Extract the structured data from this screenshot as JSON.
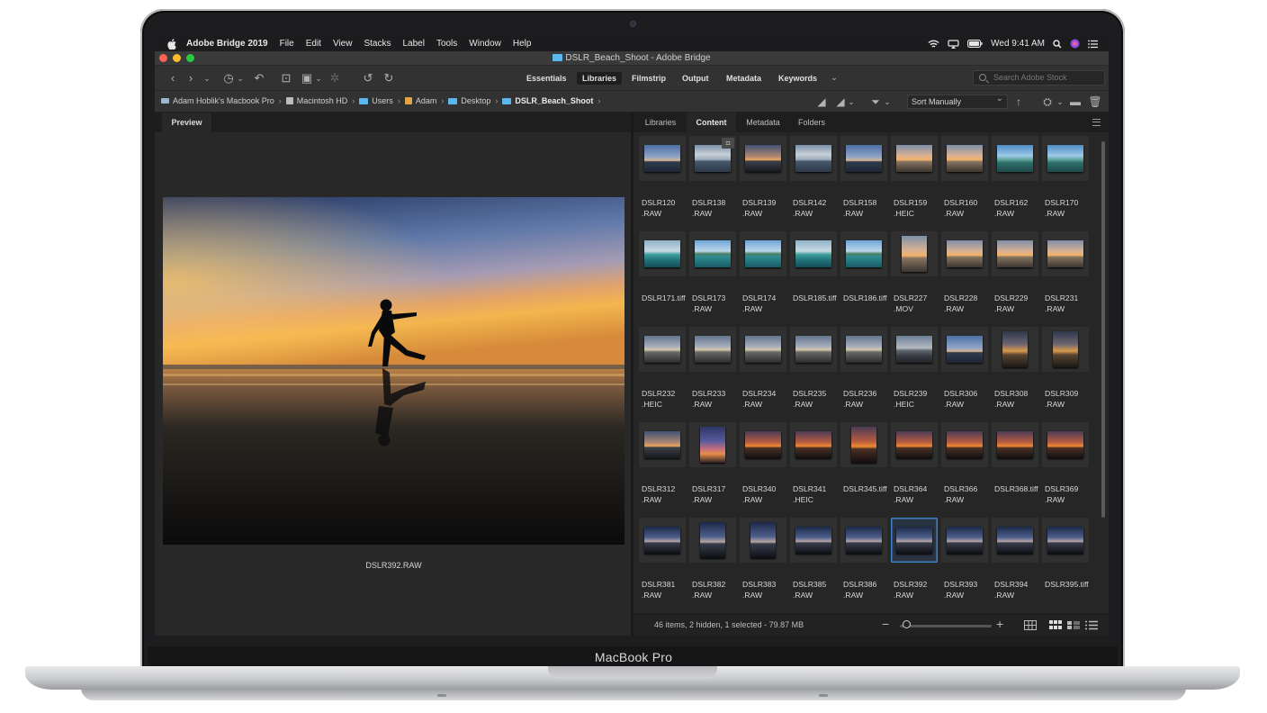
{
  "device": {
    "label": "MacBook Pro"
  },
  "menubar": {
    "app_name": "Adobe Bridge 2019",
    "items": [
      "File",
      "Edit",
      "View",
      "Stacks",
      "Label",
      "Tools",
      "Window",
      "Help"
    ],
    "clock": "Wed 9:41 AM"
  },
  "window": {
    "title": "DSLR_Beach_Shoot - Adobe Bridge",
    "traffic_light_colors": [
      "#ff5f57",
      "#febc2e",
      "#28c840"
    ]
  },
  "toolbar": {
    "workspaces": [
      "Essentials",
      "Libraries",
      "Filmstrip",
      "Output",
      "Metadata",
      "Keywords"
    ],
    "active_workspace": "Libraries",
    "search_placeholder": "Search Adobe Stock"
  },
  "path": {
    "crumbs": [
      {
        "label": "Adam Hoblik's Macbook Pro",
        "icon": "laptop-icon"
      },
      {
        "label": "Macintosh HD",
        "icon": "drive-icon"
      },
      {
        "label": "Users",
        "icon": "folder-icon"
      },
      {
        "label": "Adam",
        "icon": "home-icon"
      },
      {
        "label": "Desktop",
        "icon": "folder-icon"
      },
      {
        "label": "DSLR_Beach_Shoot",
        "icon": "folder-icon"
      }
    ],
    "sort": "Sort Manually"
  },
  "preview": {
    "tab": "Preview",
    "caption": "DSLR392.RAW"
  },
  "content": {
    "tabs": [
      "Libraries",
      "Content",
      "Metadata",
      "Folders"
    ],
    "active_tab": "Content",
    "items": [
      {
        "name": "DSLR120\n.RAW",
        "palette": "blue-dusk"
      },
      {
        "name": "DSLR138\n.RAW",
        "palette": "cloudy-sea",
        "badge": "crop-icon"
      },
      {
        "name": "DSLR139\n.RAW",
        "palette": "sunset-sea"
      },
      {
        "name": "DSLR142\n.RAW",
        "palette": "cloudy-sea"
      },
      {
        "name": "DSLR158\n.RAW",
        "palette": "blue-dusk"
      },
      {
        "name": "DSLR159\n.HEIC",
        "palette": "warm-sky"
      },
      {
        "name": "DSLR160\n.RAW",
        "palette": "warm-sky"
      },
      {
        "name": "DSLR162\n.RAW",
        "palette": "tropical"
      },
      {
        "name": "DSLR170\n.RAW",
        "palette": "tropical"
      },
      {
        "name": "DSLR171.tiff",
        "palette": "teal-boat"
      },
      {
        "name": "DSLR173\n.RAW",
        "palette": "island"
      },
      {
        "name": "DSLR174\n.RAW",
        "palette": "island"
      },
      {
        "name": "DSLR185.tiff",
        "palette": "teal-boat"
      },
      {
        "name": "DSLR186.tiff",
        "palette": "island"
      },
      {
        "name": "DSLR227\n.MOV",
        "palette": "warm-sky",
        "tall": true
      },
      {
        "name": "DSLR228\n.RAW",
        "palette": "warm-sky"
      },
      {
        "name": "DSLR229\n.RAW",
        "palette": "warm-sky"
      },
      {
        "name": "DSLR231\n.RAW",
        "palette": "warm-sky"
      },
      {
        "name": "DSLR232\n.HEIC",
        "palette": "grey-sea"
      },
      {
        "name": "DSLR233\n.RAW",
        "palette": "grey-sea"
      },
      {
        "name": "DSLR234\n.RAW",
        "palette": "grey-sea"
      },
      {
        "name": "DSLR235\n.RAW",
        "palette": "grey-sea"
      },
      {
        "name": "DSLR236\n.RAW",
        "palette": "grey-sea"
      },
      {
        "name": "DSLR239\n.HEIC",
        "palette": "figure-rock"
      },
      {
        "name": "DSLR306\n.RAW",
        "palette": "blue-dusk"
      },
      {
        "name": "DSLR308\n.RAW",
        "palette": "gold-dusk",
        "tall": true
      },
      {
        "name": "DSLR309\n.RAW",
        "palette": "gold-dusk",
        "tall": true
      },
      {
        "name": "DSLR312\n.RAW",
        "palette": "sunset-sea"
      },
      {
        "name": "DSLR317\n.RAW",
        "palette": "violet-sunset",
        "tall": true
      },
      {
        "name": "DSLR340\n.RAW",
        "palette": "orange-sunset"
      },
      {
        "name": "DSLR341\n.HEIC",
        "palette": "orange-sunset"
      },
      {
        "name": "DSLR345.tiff",
        "palette": "orange-sunset",
        "tall": true
      },
      {
        "name": "DSLR364\n.RAW",
        "palette": "orange-sunset"
      },
      {
        "name": "DSLR366\n.RAW",
        "palette": "orange-sunset"
      },
      {
        "name": "DSLR368.tiff",
        "palette": "orange-sunset"
      },
      {
        "name": "DSLR369\n.RAW",
        "palette": "orange-sunset"
      },
      {
        "name": "DSLR381\n.RAW",
        "palette": "night-beach"
      },
      {
        "name": "DSLR382\n.RAW",
        "palette": "night-beach",
        "tall": true
      },
      {
        "name": "DSLR383\n.RAW",
        "palette": "night-beach",
        "tall": true
      },
      {
        "name": "DSLR385\n.RAW",
        "palette": "night-beach"
      },
      {
        "name": "DSLR386\n.RAW",
        "palette": "night-beach"
      },
      {
        "name": "DSLR392\n.RAW",
        "palette": "night-beach",
        "selected": true
      },
      {
        "name": "DSLR393\n.RAW",
        "palette": "night-beach"
      },
      {
        "name": "DSLR394\n.RAW",
        "palette": "night-beach"
      },
      {
        "name": "DSLR395.tiff",
        "palette": "night-beach"
      }
    ],
    "status": "46 items, 2 hidden, 1 selected - 79.87 MB",
    "thumbnail_zoom": 0.05
  },
  "colors": {
    "accent": "#3d80c9",
    "panel": "#262626",
    "folder": "#5bb7ee"
  }
}
